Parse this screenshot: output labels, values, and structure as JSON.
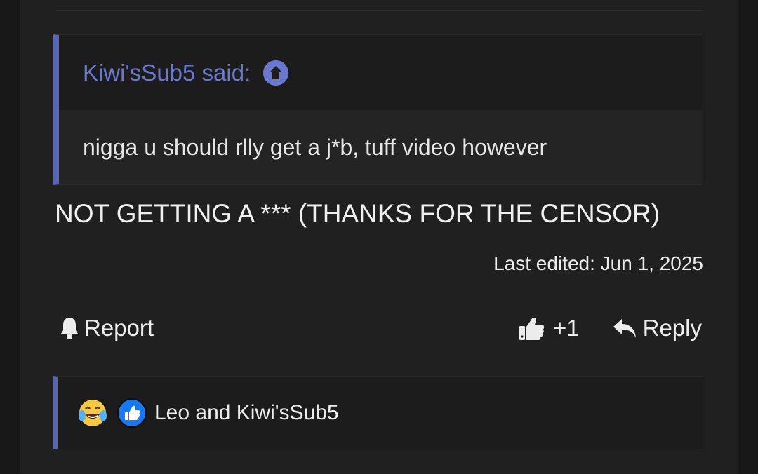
{
  "quote": {
    "author_label": "Kiwi'sSub5 said:",
    "text": "nigga u should rlly get a j*b, tuff video however"
  },
  "post": {
    "message": "NOT GETTING A *** (THANKS FOR THE CENSOR)",
    "last_edited": "Last edited: Jun 1, 2025"
  },
  "actions": {
    "report_label": "Report",
    "like_count": "+1",
    "reply_label": "Reply"
  },
  "reactions": {
    "users": "Leo and Kiwi'sSub5",
    "icons": [
      "laughing-crying-emoji",
      "like-reaction-icon"
    ]
  },
  "colors": {
    "accent": "#5865b8",
    "like_blue": "#1877f2"
  }
}
